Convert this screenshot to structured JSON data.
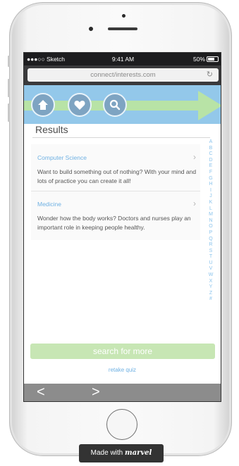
{
  "status_bar": {
    "carrier": "●●●○○ Sketch",
    "time": "9:41 AM",
    "battery": "50%"
  },
  "browser": {
    "url": "connect/interests.com",
    "reload_icon": "reload-icon"
  },
  "nav": {
    "icons": [
      "home-icon",
      "heart-icon",
      "search-icon"
    ]
  },
  "page": {
    "title": "Results"
  },
  "results": [
    {
      "title": "Computer Science",
      "description": "Want to build something out of nothing? With your mind and lots of practice you can create it all!"
    },
    {
      "title": "Medicine",
      "description": "Wonder how the body works? Doctors and nurses play an important role in keeping people healthy."
    }
  ],
  "alphabet": [
    "A",
    "B",
    "C",
    "D",
    "E",
    "F",
    "G",
    "H",
    "I",
    "J",
    "K",
    "L",
    "M",
    "N",
    "O",
    "P",
    "Q",
    "R",
    "S",
    "T",
    "U",
    "V",
    "W",
    "X",
    "Y",
    "Z",
    "#"
  ],
  "actions": {
    "search_more": "search for more",
    "retake": "retake quiz"
  },
  "footer": {
    "prev": "<",
    "next": ">"
  },
  "badge": {
    "prefix": "Made with",
    "brand": "marvel"
  },
  "colors": {
    "banner": "#93c8ea",
    "arrow": "#b8e3a6",
    "link": "#6fb1e3",
    "search_button": "#c7e6b4"
  }
}
